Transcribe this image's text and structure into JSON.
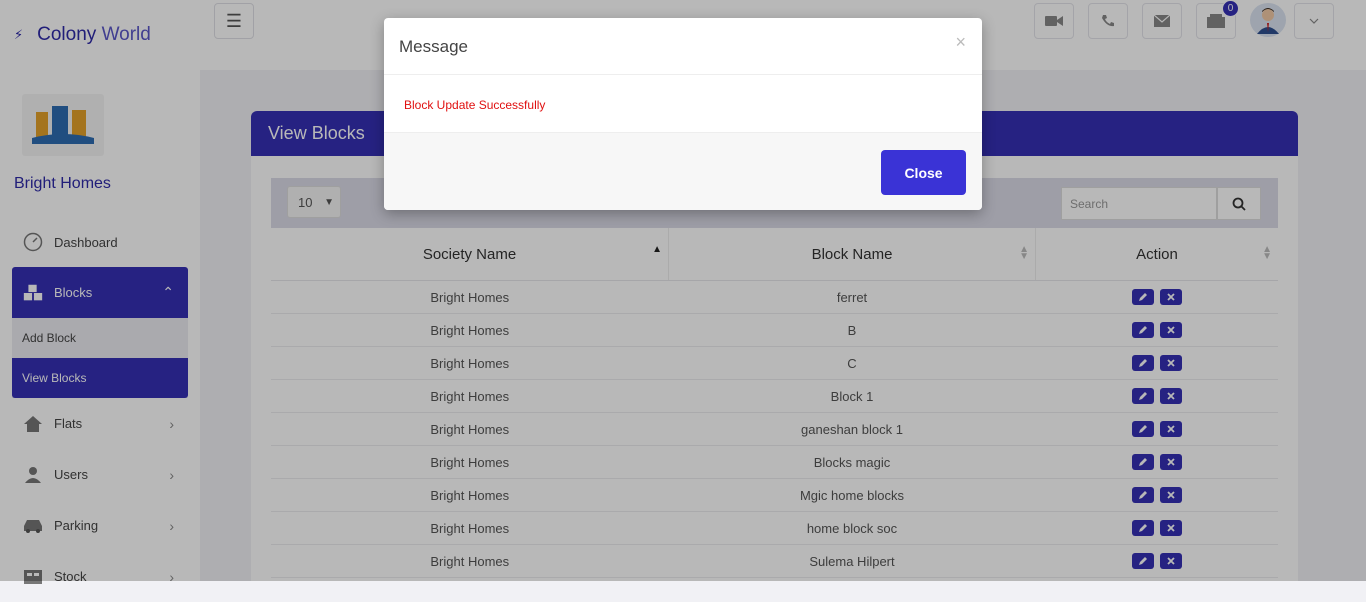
{
  "brand": {
    "name_bold": "Colony",
    "name_light": "World"
  },
  "sidebar": {
    "org_name": "Bright Homes",
    "items": [
      {
        "label": "Dashboard",
        "icon": "dashboard-icon"
      },
      {
        "label": "Blocks",
        "icon": "cubes-icon"
      },
      {
        "label": "Flats",
        "icon": "home-icon"
      },
      {
        "label": "Users",
        "icon": "user-icon"
      },
      {
        "label": "Parking",
        "icon": "car-icon"
      },
      {
        "label": "Stock",
        "icon": "stock-icon"
      }
    ],
    "blocks_sub": [
      {
        "label": "Add Block"
      },
      {
        "label": "View Blocks"
      }
    ]
  },
  "topbar": {
    "notification_count": "0"
  },
  "panel": {
    "title": "View Blocks",
    "page_length": "10",
    "search_placeholder": "Search",
    "columns": [
      "Society Name",
      "Block Name",
      "Action"
    ],
    "rows": [
      {
        "society": "Bright Homes",
        "block": "ferret"
      },
      {
        "society": "Bright Homes",
        "block": "B"
      },
      {
        "society": "Bright Homes",
        "block": "C"
      },
      {
        "society": "Bright Homes",
        "block": "Block 1"
      },
      {
        "society": "Bright Homes",
        "block": "ganeshan block 1"
      },
      {
        "society": "Bright Homes",
        "block": "Blocks magic"
      },
      {
        "society": "Bright Homes",
        "block": "Mgic home blocks"
      },
      {
        "society": "Bright Homes",
        "block": "home block soc"
      },
      {
        "society": "Bright Homes",
        "block": "Sulema Hilpert"
      }
    ]
  },
  "modal": {
    "title": "Message",
    "close_x": "×",
    "message": "Block Update Successfully",
    "close_label": "Close"
  },
  "colors": {
    "accent": "#3530b5",
    "button": "#3a33d6",
    "error_text": "#e01010"
  }
}
